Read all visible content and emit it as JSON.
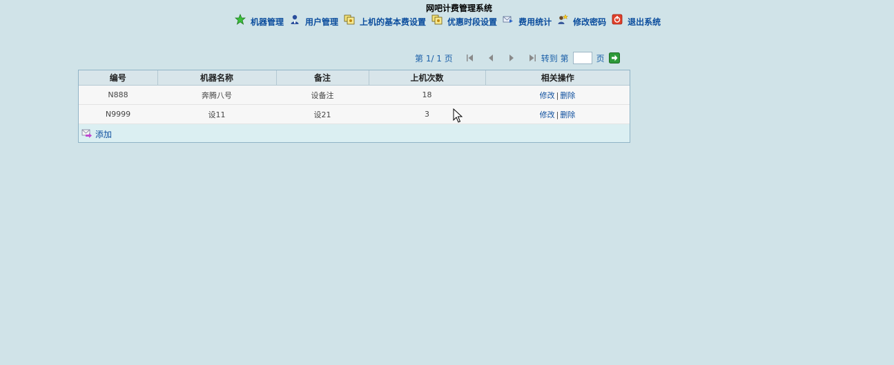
{
  "header": {
    "title": "网吧计费管理系统"
  },
  "nav": [
    {
      "label": "机器管理",
      "icon": "star-icon"
    },
    {
      "label": "用户管理",
      "icon": "user-icon"
    },
    {
      "label": "上机的基本费设置",
      "icon": "folders-icon"
    },
    {
      "label": "优惠时段设置",
      "icon": "folders-icon"
    },
    {
      "label": "费用统计",
      "icon": "mail-arrow-icon"
    },
    {
      "label": "修改密码",
      "icon": "user-key-icon"
    },
    {
      "label": "退出系统",
      "icon": "power-icon"
    }
  ],
  "pager": {
    "page_info": "第 1/ 1 页",
    "goto_label": "转到 第",
    "page_unit": "页",
    "page_input_value": ""
  },
  "table": {
    "headers": [
      "编号",
      "机器名称",
      "备注",
      "上机次数",
      "相关操作"
    ],
    "rows": [
      {
        "id": "N888",
        "name": "奔腾八号",
        "remark": "设备注",
        "count": "18",
        "edit": "修改",
        "sep": "|",
        "delete": "删除"
      },
      {
        "id": "N9999",
        "name": "设11",
        "remark": "设21",
        "count": "3",
        "edit": "修改",
        "sep": "|",
        "delete": "删除"
      }
    ],
    "add_label": "添加"
  },
  "colors": {
    "background": "#d0e3e8",
    "link": "#0b4d9d",
    "header_bg": "#d8e5ea",
    "footer_bg": "#dbeff2"
  }
}
